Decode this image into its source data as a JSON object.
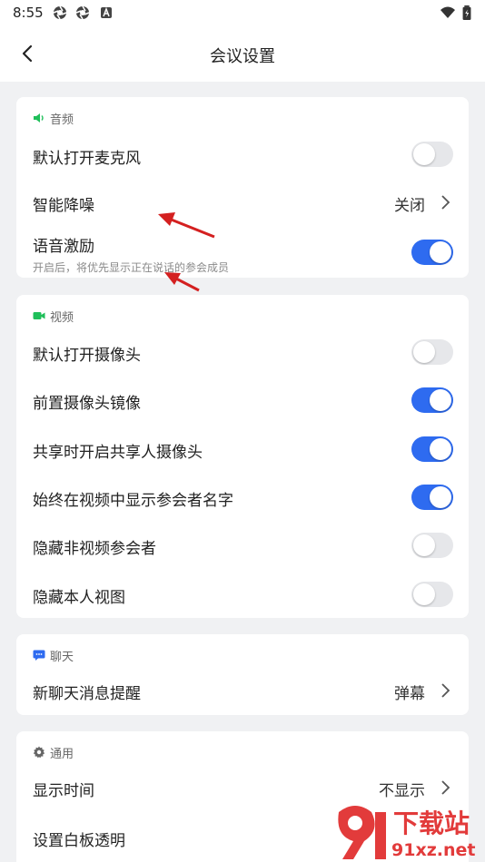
{
  "status": {
    "time": "8:55"
  },
  "header": {
    "title": "会议设置"
  },
  "audio": {
    "section_label": "音频",
    "default_mic": {
      "label": "默认打开麦克风",
      "on": false
    },
    "noise": {
      "label": "智能降噪",
      "value": "关闭"
    },
    "voice_excite": {
      "label": "语音激励",
      "desc": "开启后，将优先显示正在说话的参会成员",
      "on": true
    }
  },
  "video": {
    "section_label": "视频",
    "rows": [
      {
        "label": "默认打开摄像头",
        "on": false
      },
      {
        "label": "前置摄像头镜像",
        "on": true
      },
      {
        "label": "共享时开启共享人摄像头",
        "on": true
      },
      {
        "label": "始终在视频中显示参会者名字",
        "on": true
      },
      {
        "label": "隐藏非视频参会者",
        "on": false
      },
      {
        "label": "隐藏本人视图",
        "on": false
      }
    ]
  },
  "chat": {
    "section_label": "聊天",
    "new_msg": {
      "label": "新聊天消息提醒",
      "value": "弹幕"
    }
  },
  "general": {
    "section_label": "通用",
    "show_time": {
      "label": "显示时间",
      "value": "不显示"
    },
    "whiteboard": {
      "label": "设置白板透明"
    }
  },
  "watermark": {
    "text": "下载站",
    "url": "91xz.net"
  },
  "colors": {
    "accent": "#2e6bf0",
    "green": "#1fbf5a",
    "annotation": "#d42020"
  }
}
